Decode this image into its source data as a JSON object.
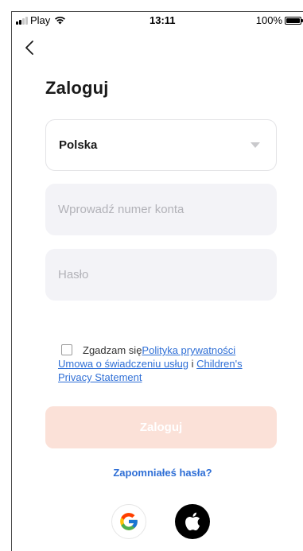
{
  "status_bar": {
    "carrier": "Play",
    "time": "13:11",
    "battery": "100%"
  },
  "header": {
    "back_icon": "chevron-left-icon",
    "title": "Zaloguj"
  },
  "form": {
    "country": {
      "selected": "Polska",
      "icon": "triangle-down-icon"
    },
    "account": {
      "placeholder": "Wprowadź numer konta",
      "value": ""
    },
    "password": {
      "placeholder": "Hasło",
      "value": ""
    },
    "agreement": {
      "checked": false,
      "prefix": "Zgadzam się",
      "privacy_link": "Polityka prywatności",
      "terms_link": "Umowa o świadczeniu usług",
      "conjunction": "i",
      "children_link": "Children's Privacy Statement"
    },
    "login_label": "Zaloguj",
    "forgot_label": "Zapomniałeś hasła?"
  },
  "social": {
    "google_icon": "google-icon",
    "apple_icon": "apple-icon"
  },
  "colors": {
    "accent": "#2f6fd6",
    "login_disabled_bg": "#fbe1d8",
    "input_bg": "#f3f3f7"
  }
}
